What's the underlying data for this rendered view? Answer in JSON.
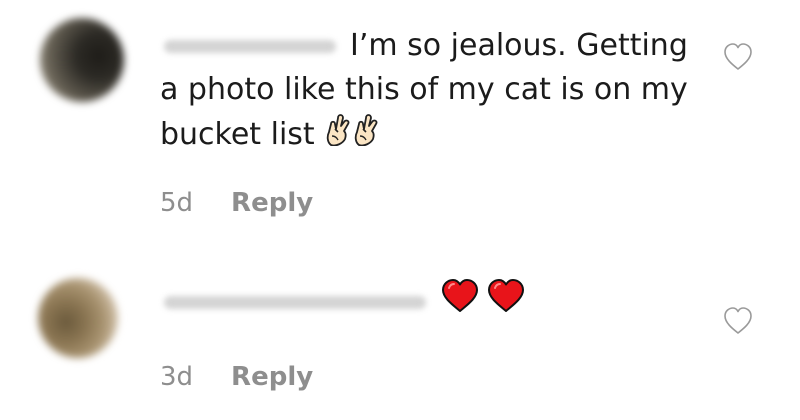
{
  "comments": [
    {
      "text": "I’m so jealous. Getting a photo like this of my cat is on my bucket list",
      "emojis": [
        "crossed-fingers-emoji",
        "crossed-fingers-emoji"
      ],
      "time": "5d",
      "reply_label": "Reply",
      "like_icon": "heart-outline-icon"
    },
    {
      "text": "",
      "emojis": [
        "red-heart-emoji",
        "red-heart-emoji"
      ],
      "time": "3d",
      "reply_label": "Reply",
      "like_icon": "heart-outline-icon"
    }
  ],
  "colors": {
    "text": "#1b1b1b",
    "meta": "#8e8e8e",
    "heart_red": "#e8141a"
  }
}
